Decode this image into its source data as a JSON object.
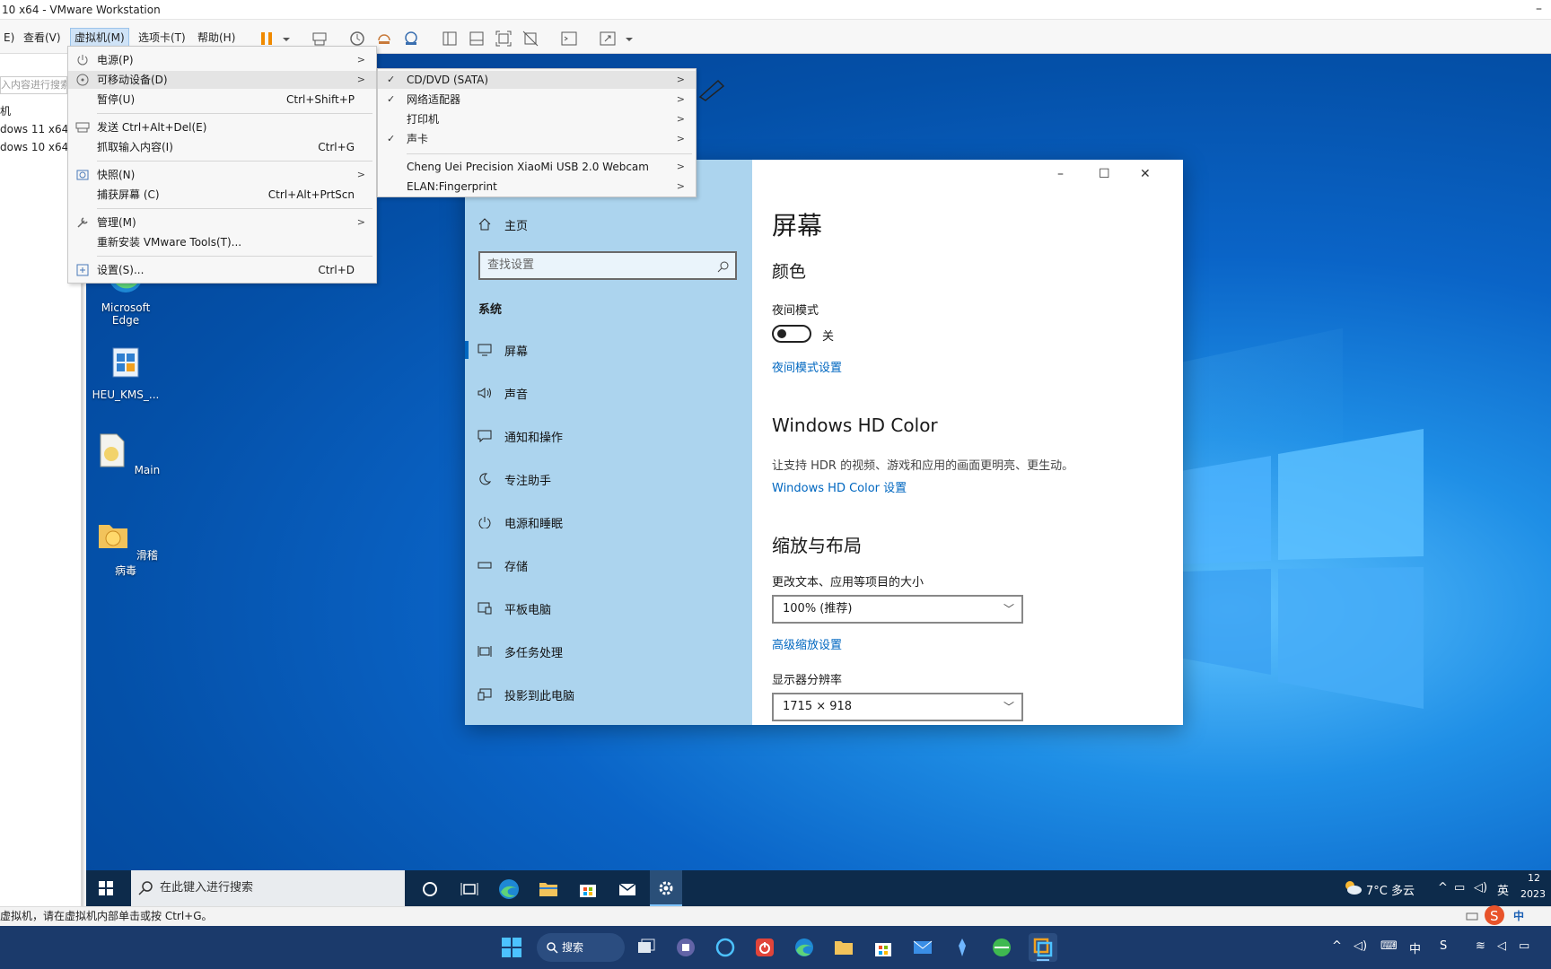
{
  "window": {
    "title": "10 x64 - VMware Workstation"
  },
  "menubar": {
    "items": [
      "E)",
      "查看(V)",
      "虚拟机(M)",
      "选项卡(T)",
      "帮助(H)"
    ]
  },
  "library": {
    "search_placeholder": "入内容进行搜索",
    "items": [
      "机",
      "dows 11 x64 (",
      "dows 10 x64"
    ]
  },
  "vm_menu": {
    "items": [
      {
        "label": "电源(P)",
        "shortcut": "",
        "submenu": true
      },
      {
        "label": "可移动设备(D)",
        "shortcut": "",
        "submenu": true,
        "highlighted": true
      },
      {
        "label": "暂停(U)",
        "shortcut": "Ctrl+Shift+P",
        "submenu": false
      },
      {
        "label": "发送 Ctrl+Alt+Del(E)",
        "shortcut": "",
        "submenu": false
      },
      {
        "label": "抓取输入内容(I)",
        "shortcut": "Ctrl+G",
        "submenu": false
      },
      {
        "label": "快照(N)",
        "shortcut": "",
        "submenu": true
      },
      {
        "label": "捕获屏幕 (C)",
        "shortcut": "Ctrl+Alt+PrtScn",
        "submenu": false
      },
      {
        "label": "管理(M)",
        "shortcut": "",
        "submenu": true
      },
      {
        "label": "重新安装 VMware Tools(T)...",
        "shortcut": "",
        "submenu": false
      },
      {
        "label": "设置(S)...",
        "shortcut": "Ctrl+D",
        "submenu": false
      }
    ]
  },
  "removable_menu": {
    "items": [
      {
        "label": "CD/DVD (SATA)",
        "checked": true
      },
      {
        "label": "网络适配器",
        "checked": true
      },
      {
        "label": "打印机",
        "checked": false
      },
      {
        "label": "声卡",
        "checked": true
      },
      {
        "label": "Cheng Uei Precision XiaoMi USB 2.0 Webcam",
        "checked": false
      },
      {
        "label": "ELAN:Fingerprint",
        "checked": false
      }
    ]
  },
  "desktop": {
    "icons": [
      "Microsoft Edge",
      "HEU_KMS_...",
      "Main",
      "滑稽病毒"
    ]
  },
  "settings": {
    "home": "主页",
    "search_placeholder": "查找设置",
    "section": "系统",
    "nav": [
      "屏幕",
      "声音",
      "通知和操作",
      "专注助手",
      "电源和睡眠",
      "存储",
      "平板电脑",
      "多任务处理",
      "投影到此电脑"
    ],
    "page_title": "屏幕",
    "color_heading": "颜色",
    "night_mode_label": "夜间模式",
    "night_mode_state": "关",
    "night_mode_link": "夜间模式设置",
    "hdr_heading": "Windows HD Color",
    "hdr_desc": "让支持 HDR 的视频、游戏和应用的画面更明亮、更生动。",
    "hdr_link": "Windows HD Color 设置",
    "scale_heading": "缩放与布局",
    "scale_label": "更改文本、应用等项目的大小",
    "scale_value": "100% (推荐)",
    "scale_link": "高级缩放设置",
    "res_label": "显示器分辨率",
    "res_value": "1715 × 918"
  },
  "guest_taskbar": {
    "search_placeholder": "在此键入进行搜索",
    "weather": "7°C 多云",
    "ime": "英",
    "time": "12",
    "date": "2023"
  },
  "status_bar": {
    "text": "虚拟机，请在虚拟机内部单击或按 Ctrl+G。"
  },
  "host_taskbar": {
    "search_label": "搜索",
    "ime": "中"
  },
  "colors": {
    "accent": "#0067c0",
    "settings_sidebar": "#acd4ee",
    "desktop": "#0a64c7"
  }
}
